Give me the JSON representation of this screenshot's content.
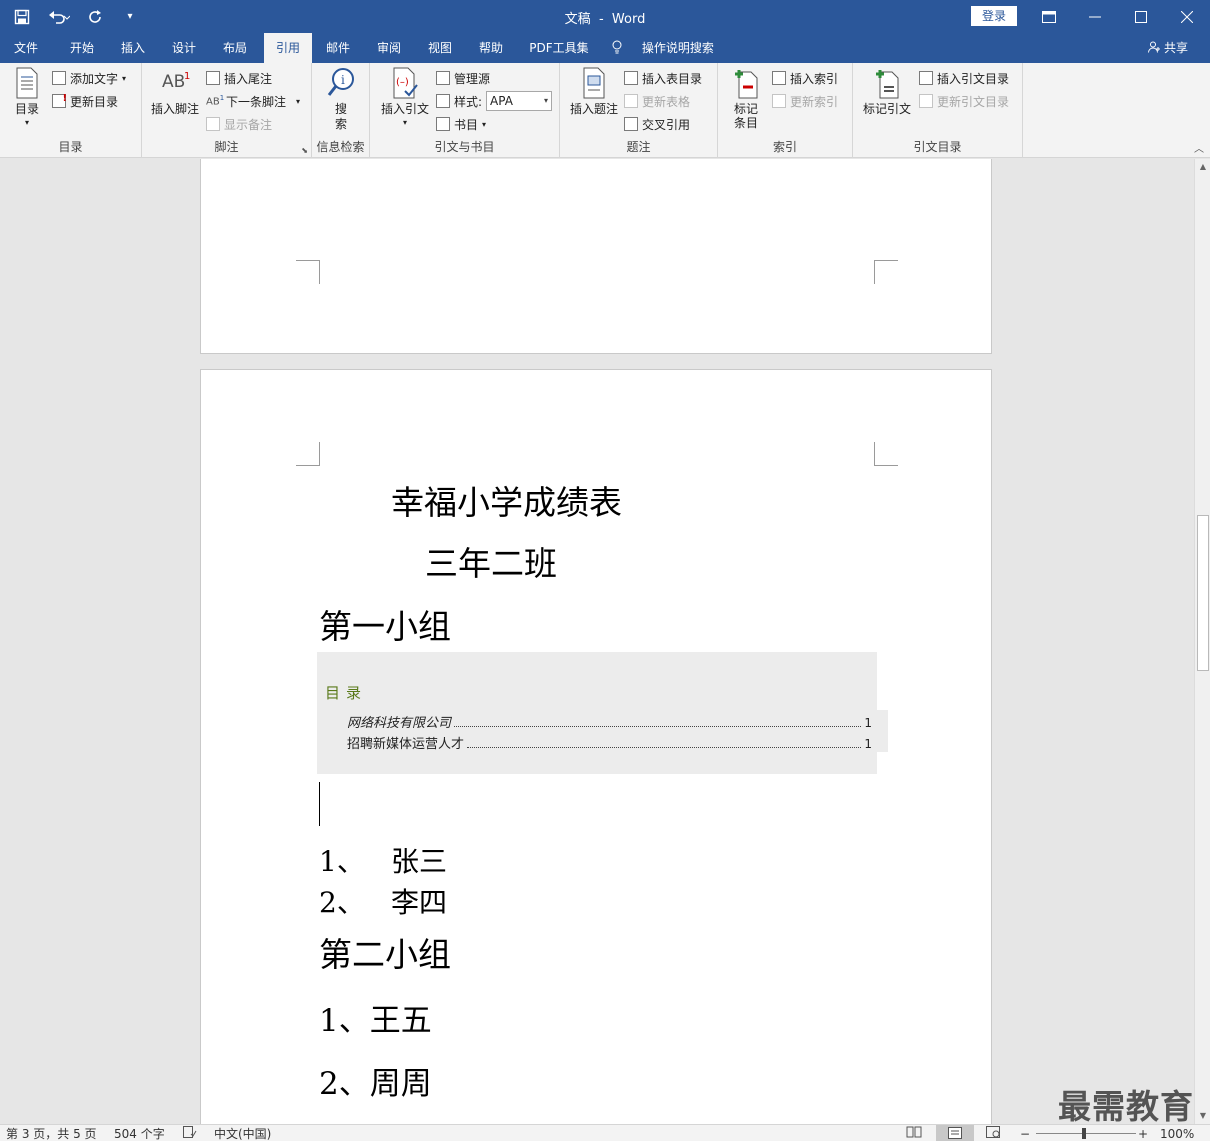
{
  "title_bar": {
    "doc_name": "文稿",
    "separator": "-",
    "app_name": "Word",
    "login_label": "登录"
  },
  "tabs": [
    "文件",
    "开始",
    "插入",
    "设计",
    "布局",
    "引用",
    "邮件",
    "审阅",
    "视图",
    "帮助",
    "PDF工具集",
    "操作说明搜索"
  ],
  "active_tab": "引用",
  "share_label": "共享",
  "ribbon": {
    "toc_group": {
      "label": "目录",
      "toc_button": "目录",
      "add_text": "添加文字",
      "update_toc": "更新目录"
    },
    "footnote_group": {
      "label": "脚注",
      "insert_footnote": "插入脚注",
      "insert_endnote": "插入尾注",
      "next_footnote": "下一条脚注",
      "show_notes": "显示备注"
    },
    "research_group": {
      "label": "信息检索",
      "search": "搜索"
    },
    "citations_group": {
      "label": "引文与书目",
      "insert_citation": "插入引文",
      "manage_sources": "管理源",
      "style_label": "样式:",
      "style_value": "APA",
      "bibliography": "书目"
    },
    "captions_group": {
      "label": "题注",
      "insert_caption": "插入题注",
      "insert_table_of_figures": "插入表目录",
      "update_table": "更新表格",
      "cross_reference": "交叉引用"
    },
    "index_group": {
      "label": "索引",
      "mark_entry": "标记条目",
      "insert_index": "插入索引",
      "update_index": "更新索引"
    },
    "toa_group": {
      "label": "引文目录",
      "mark_citation": "标记引文",
      "insert_toa": "插入引文目录",
      "update_toa": "更新引文目录"
    }
  },
  "document": {
    "title": "幸福小学成绩表",
    "subtitle": "三年二班",
    "group1_heading": "第一小组",
    "toc": {
      "heading": "目录",
      "entries": [
        {
          "text": "网络科技有限公司",
          "page": "1"
        },
        {
          "text": "招聘新媒体运营人才",
          "page": "1"
        }
      ]
    },
    "group1_list": [
      {
        "num": "1、",
        "name": "张三"
      },
      {
        "num": "2、",
        "name": "李四"
      }
    ],
    "group2_heading": "第二小组",
    "group2_list": [
      {
        "num": "1、",
        "name": "王五"
      },
      {
        "num": "2、",
        "name": "周周"
      }
    ]
  },
  "status_bar": {
    "page_info": "第 3 页，共 5 页",
    "word_count": "504 个字",
    "language": "中文(中国)",
    "zoom": "100%"
  },
  "watermark": "最需教育"
}
